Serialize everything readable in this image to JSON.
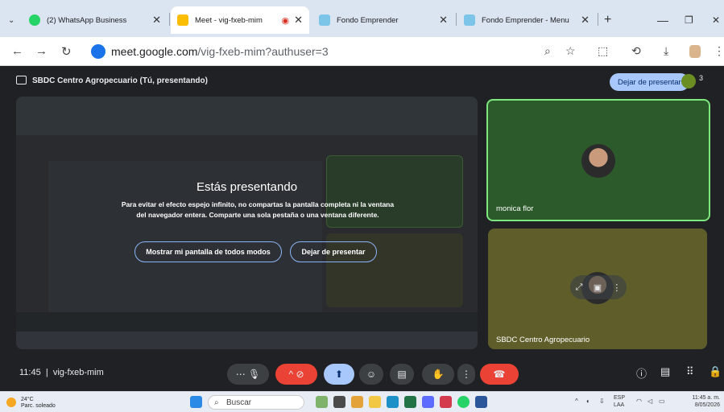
{
  "browser": {
    "tabs": [
      {
        "title": "(2) WhatsApp Business",
        "fav": "#25d366",
        "active": false
      },
      {
        "title": "Meet - vig-fxeb-mim",
        "fav": "#fbbc04",
        "active": true
      },
      {
        "title": "Fondo Emprender",
        "fav": "#7cc5e8",
        "active": false
      },
      {
        "title": "Fondo Emprender - Menu",
        "fav": "#7cc5e8",
        "active": false
      }
    ],
    "url_host": "meet.google.com",
    "url_path": "/vig-fxeb-mim?authuser=3"
  },
  "meet": {
    "header_title": "SBDC Centro Agropecuario (Tú, presentando)",
    "stop_label": "Dejar de presentar",
    "participant_count": "3",
    "overlay": {
      "title": "Estás presentando",
      "text": "Para evitar el efecto espejo infinito, no compartas la pantalla completa ni la ventana del navegador entera. Comparte una sola pestaña o una ventana diferente.",
      "show_anyway": "Mostrar mi pantalla de todos modos",
      "stop": "Dejar de presentar"
    },
    "tiles": [
      {
        "name": "monica flor"
      },
      {
        "name": "SBDC Centro Agropecuario"
      }
    ],
    "time": "11:45",
    "meeting_code": "vig-fxeb-mim"
  },
  "taskbar": {
    "temp": "24°C",
    "weather": "Parc. soleado",
    "search": "Buscar",
    "lang1": "ESP",
    "lang2": "LAA",
    "clock_time": "11:45 a. m.",
    "clock_date": "8/05/2026"
  }
}
